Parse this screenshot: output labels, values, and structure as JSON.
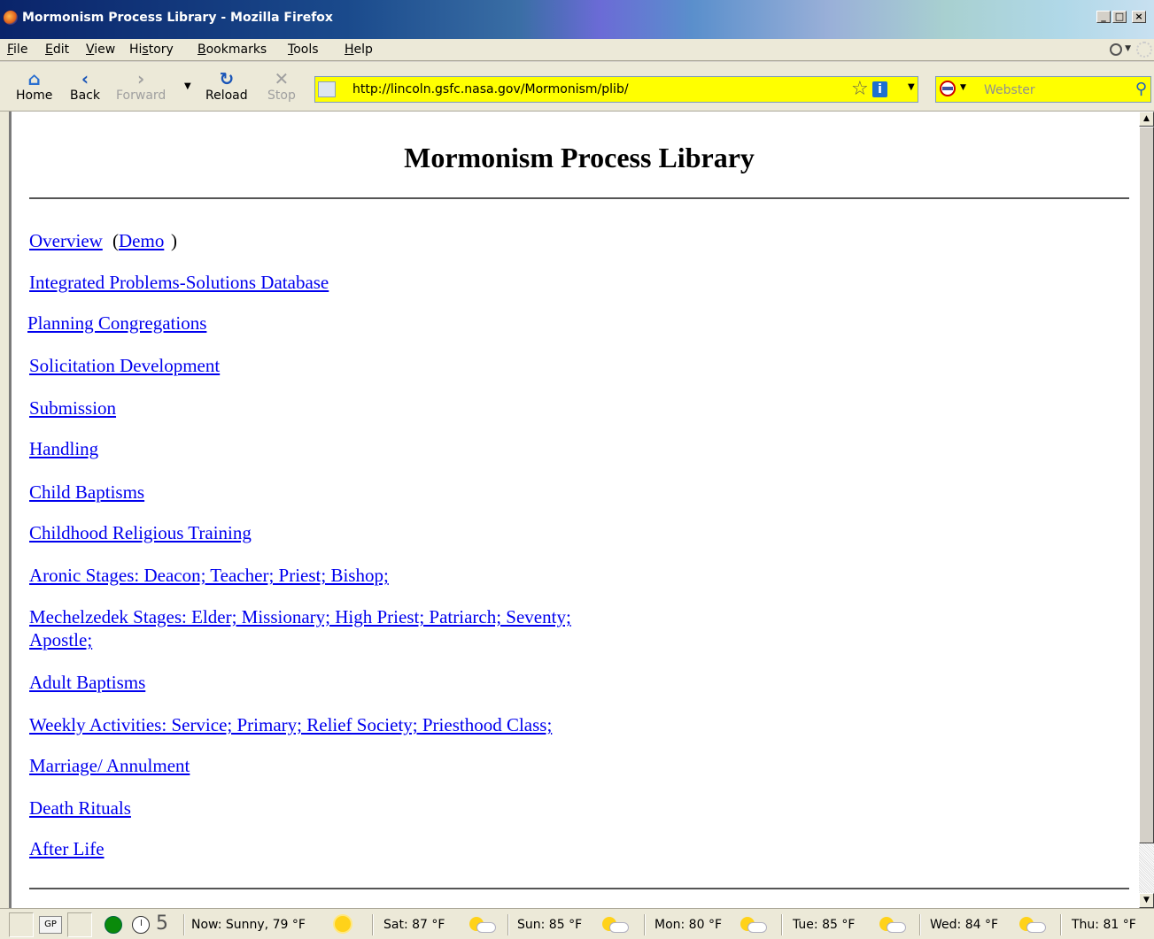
{
  "window": {
    "title": "Mormonism Process Library - Mozilla Firefox",
    "controls": {
      "minimize": "_",
      "maximize": "□",
      "close": "×"
    }
  },
  "menu": [
    {
      "label": "File",
      "accesskey": "F",
      "rest": "ile"
    },
    {
      "label": "Edit",
      "accesskey": "E",
      "rest": "dit"
    },
    {
      "label": "View",
      "accesskey": "V",
      "rest": "iew"
    },
    {
      "label": "History",
      "pre": "Hi",
      "accesskey": "s",
      "rest": "tory"
    },
    {
      "label": "Bookmarks",
      "accesskey": "B",
      "rest": "ookmarks"
    },
    {
      "label": "Tools",
      "accesskey": "T",
      "rest": "ools"
    },
    {
      "label": "Help",
      "accesskey": "H",
      "rest": "elp"
    }
  ],
  "toolbar": {
    "home": "Home",
    "back": "Back",
    "forward": "Forward",
    "reload": "Reload",
    "stop": "Stop",
    "url": "http://lincoln.gsfc.nasa.gov/Mormonism/plib/",
    "search_placeholder": "Webster"
  },
  "page": {
    "heading": "Mormonism Process Library",
    "links": [
      "Overview",
      "Demo",
      "Integrated Problems-Solutions Database",
      "Planning Congregations",
      "Solicitation Development",
      "Submission",
      "Handling",
      "Child Baptisms",
      "Childhood Religious Training",
      "Aronic Stages: Deacon; Teacher; Priest; Bishop;",
      "Mechelzedek Stages: Elder; Missionary; High Priest; Patriarch; Seventy;",
      "Apostle;",
      "Adult Baptisms",
      "Weekly Activities: Service; Primary; Relief Society; Priesthood Class;",
      "Marriage/ Annulment",
      "Death Rituals",
      "After Life"
    ],
    "paren_open": "(",
    "paren_close": ")"
  },
  "statusbar": {
    "gp": "GP",
    "counter": "5",
    "now": "Now: Sunny, 79 °F",
    "forecast": [
      "Sat: 87 °F",
      "Sun: 85 °F",
      "Mon: 80 °F",
      "Tue: 85 °F",
      "Wed: 84 °F",
      "Thu: 81 °F"
    ]
  },
  "colors": {
    "link": "#0000ee",
    "address_bar_bg": "#ffff00",
    "chrome_bg": "#ece9d8"
  }
}
